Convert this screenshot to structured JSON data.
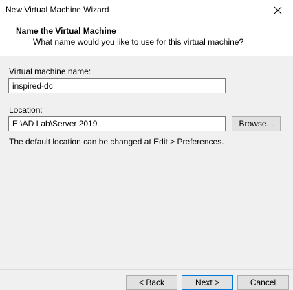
{
  "window": {
    "title": "New Virtual Machine Wizard"
  },
  "header": {
    "title": "Name the Virtual Machine",
    "subtitle": "What name would you like to use for this virtual machine?"
  },
  "form": {
    "vm_name_label": "Virtual machine name:",
    "vm_name_value": "inspired-dc",
    "location_label": "Location:",
    "location_value": "E:\\AD Lab\\Server 2019",
    "browse_label": "Browse...",
    "hint": "The default location can be changed at Edit > Preferences."
  },
  "footer": {
    "back_label": "< Back",
    "next_label": "Next >",
    "cancel_label": "Cancel"
  },
  "icons": {
    "close": "close-icon"
  },
  "colors": {
    "accent": "#0078d7",
    "header_bg": "#ffffff",
    "body_bg": "#f0f0f0"
  }
}
